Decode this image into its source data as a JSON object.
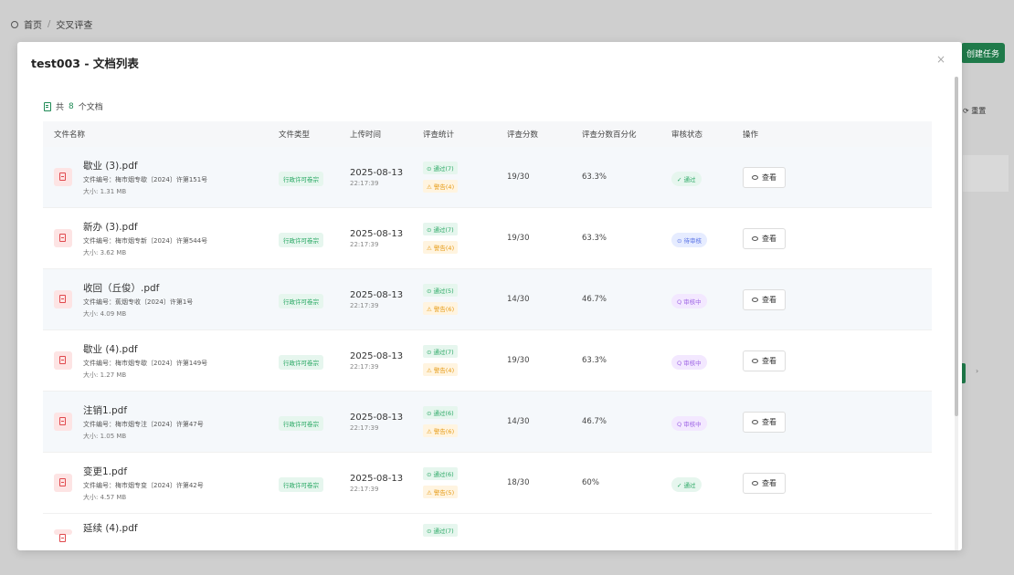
{
  "background": {
    "breadcrumb": {
      "home": "首页",
      "separator": "/",
      "current": "交叉评查"
    },
    "create_button": "创建任务",
    "reset_button": "重置"
  },
  "modal": {
    "title": "test003 - 文档列表",
    "close": "×",
    "count_prefix": "共",
    "count": "8",
    "count_suffix": "个文档"
  },
  "table": {
    "headers": {
      "name": "文件名称",
      "type": "文件类型",
      "time": "上传时间",
      "stat": "评查统计",
      "score": "评查分数",
      "pct": "评查分数百分化",
      "status": "审核状态",
      "action": "操作"
    },
    "rows": [
      {
        "name": "歇业 (3).pdf",
        "meta": "文件编号：梅市烟专歇〔2024〕许第151号",
        "size": "大小: 1.31 MB",
        "type": "行政许可卷宗",
        "date": "2025-08-13",
        "clock": "22:17:39",
        "pass": "⊙ 通过(7)",
        "warn": "⚠ 警告(4)",
        "score": "19/30",
        "pct": "63.3%",
        "status": "✓ 通过",
        "status_kind": "pass",
        "action": "查看"
      },
      {
        "name": "新办 (3).pdf",
        "meta": "文件编号：梅市烟专新〔2024〕许第544号",
        "size": "大小: 3.62 MB",
        "type": "行政许可卷宗",
        "date": "2025-08-13",
        "clock": "22:17:39",
        "pass": "⊙ 通过(7)",
        "warn": "⚠ 警告(4)",
        "score": "19/30",
        "pct": "63.3%",
        "status": "⊙ 待审核",
        "status_kind": "pending",
        "action": "查看"
      },
      {
        "name": "收回（丘俊）.pdf",
        "meta": "文件编号：蕉烟专收〔2024〕许第1号",
        "size": "大小: 4.09 MB",
        "type": "行政许可卷宗",
        "date": "2025-08-13",
        "clock": "22:17:39",
        "pass": "⊙ 通过(5)",
        "warn": "⚠ 警告(6)",
        "score": "14/30",
        "pct": "46.7%",
        "status": "Q 审核中",
        "status_kind": "review",
        "action": "查看"
      },
      {
        "name": "歇业 (4).pdf",
        "meta": "文件编号：梅市烟专歇〔2024〕许第149号",
        "size": "大小: 1.27 MB",
        "type": "行政许可卷宗",
        "date": "2025-08-13",
        "clock": "22:17:39",
        "pass": "⊙ 通过(7)",
        "warn": "⚠ 警告(4)",
        "score": "19/30",
        "pct": "63.3%",
        "status": "Q 审核中",
        "status_kind": "review",
        "action": "查看"
      },
      {
        "name": "注销1.pdf",
        "meta": "文件编号：梅市烟专注〔2024〕许第47号",
        "size": "大小: 1.05 MB",
        "type": "行政许可卷宗",
        "date": "2025-08-13",
        "clock": "22:17:39",
        "pass": "⊙ 通过(6)",
        "warn": "⚠ 警告(6)",
        "score": "14/30",
        "pct": "46.7%",
        "status": "Q 审核中",
        "status_kind": "review",
        "action": "查看"
      },
      {
        "name": "变更1.pdf",
        "meta": "文件编号：梅市烟专变〔2024〕许第42号",
        "size": "大小: 4.57 MB",
        "type": "行政许可卷宗",
        "date": "2025-08-13",
        "clock": "22:17:39",
        "pass": "⊙ 通过(6)",
        "warn": "⚠ 警告(5)",
        "score": "18/30",
        "pct": "60%",
        "status": "✓ 通过",
        "status_kind": "pass",
        "action": "查看"
      }
    ],
    "partial_row": {
      "name": "延续 (4).pdf",
      "pass": "⊙ 通过(7)"
    }
  }
}
